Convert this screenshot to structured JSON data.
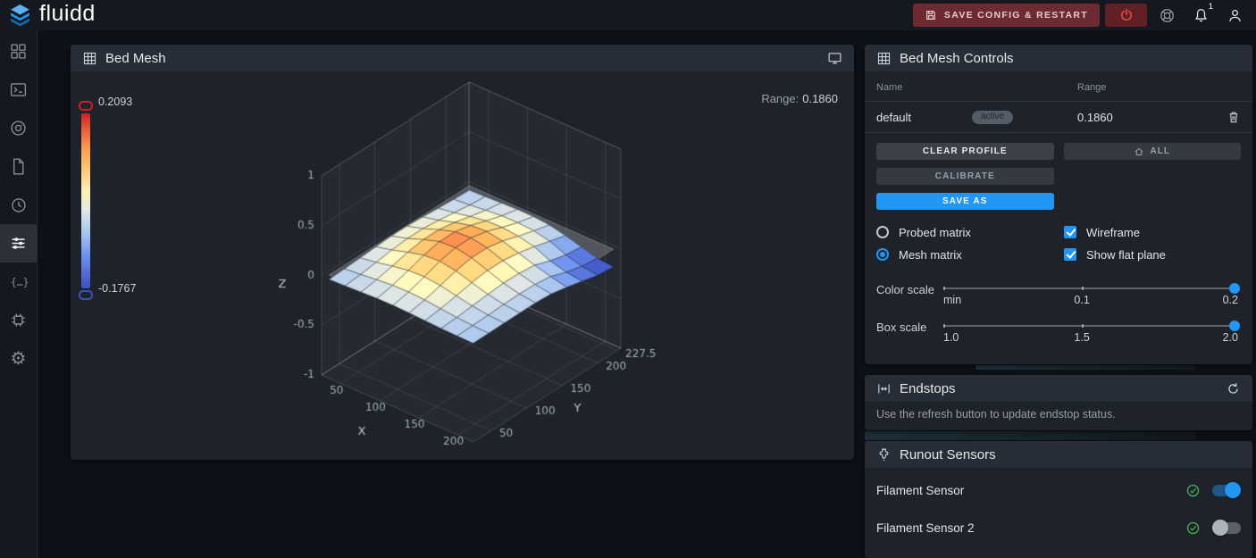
{
  "topbar": {
    "logo": "fluidd",
    "save_config_label": "SAVE CONFIG & RESTART",
    "notification_count": "1"
  },
  "sidebar": {
    "active": "tune",
    "items": [
      "dashboard",
      "console",
      "camera",
      "jobs",
      "history",
      "tune",
      "macros",
      "system",
      "settings"
    ]
  },
  "bed_mesh_card": {
    "title": "Bed Mesh",
    "range_label": "Range:",
    "range_value": "0.1860",
    "colorbar_max": "0.2093",
    "colorbar_min": "-0.1767"
  },
  "chart_data": {
    "type": "surface",
    "title": "Bed Mesh",
    "xlabel": "X",
    "ylabel": "Y",
    "zlabel": "Z",
    "x_range": [
      25,
      220
    ],
    "y_range": [
      25,
      232.5
    ],
    "z_range": [
      -1,
      1
    ],
    "x_ticks": [
      50,
      100,
      150,
      200
    ],
    "y_ticks": [
      50,
      100,
      150,
      200,
      227.5
    ],
    "z_ticks": [
      1,
      0.5,
      0,
      -0.5,
      -1
    ],
    "color_min": -0.1767,
    "color_max": 0.2093,
    "flat_plane": true,
    "wireframe": true,
    "colorscale": [
      [
        0,
        "#3b4fc1"
      ],
      [
        0.18,
        "#6b8ff0"
      ],
      [
        0.32,
        "#a8c6f0"
      ],
      [
        0.45,
        "#e2e8e4"
      ],
      [
        0.55,
        "#fbf2b8"
      ],
      [
        0.68,
        "#fdc877"
      ],
      [
        0.8,
        "#fb9b4f"
      ],
      [
        0.9,
        "#ee613d"
      ],
      [
        1,
        "#cb2026"
      ]
    ],
    "x": [
      30,
      50.6,
      71.1,
      91.7,
      112.2,
      132.8,
      153.3,
      173.9,
      194.4,
      215
    ],
    "y": [
      30,
      51.9,
      73.9,
      95.8,
      117.8,
      139.7,
      161.7,
      183.6,
      205.6,
      227.5
    ],
    "z": [
      [
        -0.045,
        -0.039,
        -0.031,
        -0.024,
        -0.023,
        -0.027,
        -0.035,
        -0.042,
        -0.047,
        -0.049
      ],
      [
        -0.038,
        -0.024,
        -0.006,
        0.009,
        0.012,
        0.004,
        -0.014,
        -0.031,
        -0.042,
        -0.048
      ],
      [
        -0.028,
        -0.002,
        0.031,
        0.058,
        0.065,
        0.048,
        0.016,
        -0.015,
        -0.036,
        -0.045
      ],
      [
        -0.016,
        0.022,
        0.071,
        0.112,
        0.122,
        0.096,
        0.049,
        0.003,
        -0.028,
        -0.043
      ],
      [
        -0.008,
        0.038,
        0.098,
        0.148,
        0.158,
        0.128,
        0.071,
        0.015,
        -0.023,
        -0.041
      ],
      [
        -0.008,
        0.038,
        0.098,
        0.148,
        0.158,
        0.128,
        0.071,
        0.013,
        -0.027,
        -0.052
      ],
      [
        -0.016,
        0.022,
        0.071,
        0.112,
        0.122,
        0.096,
        0.047,
        -0.004,
        -0.048,
        -0.084
      ],
      [
        -0.028,
        -0.002,
        0.031,
        0.058,
        0.064,
        0.046,
        0.012,
        -0.06,
        -0.104,
        -0.122
      ],
      [
        -0.038,
        -0.024,
        -0.006,
        0.009,
        0.011,
        0.0,
        -0.034,
        -0.099,
        -0.143,
        -0.163
      ],
      [
        -0.045,
        -0.039,
        -0.031,
        -0.025,
        -0.026,
        -0.04,
        -0.076,
        -0.119,
        -0.162,
        -0.1767
      ]
    ]
  },
  "controls_card": {
    "title": "Bed Mesh Controls",
    "col_name": "Name",
    "col_range": "Range",
    "profile": {
      "name": "default",
      "badge": "active",
      "range": "0.1860"
    },
    "btn_clear": "CLEAR PROFILE",
    "btn_all": "ALL",
    "btn_calibrate": "CALIBRATE",
    "btn_save_as": "SAVE AS",
    "radio_probed": {
      "label": "Probed matrix",
      "selected": false
    },
    "radio_mesh": {
      "label": "Mesh matrix",
      "selected": true
    },
    "check_wireframe": {
      "label": "Wireframe",
      "checked": true
    },
    "check_flat": {
      "label": "Show flat plane",
      "checked": true
    },
    "color_scale": {
      "label": "Color scale",
      "tick_labels": [
        "min",
        "0.1",
        "0.2"
      ],
      "value": 1
    },
    "box_scale": {
      "label": "Box scale",
      "tick_labels": [
        "1.0",
        "1.5",
        "2.0"
      ],
      "value": 1
    }
  },
  "endstops_card": {
    "title": "Endstops",
    "hint": "Use the refresh button to update endstop status."
  },
  "runout_card": {
    "title": "Runout Sensors",
    "sensors": [
      {
        "label": "Filament Sensor",
        "enabled": true
      },
      {
        "label": "Filament Sensor 2",
        "enabled": false
      }
    ]
  },
  "colors": {
    "accent": "#2196f3",
    "success": "#4caf50",
    "danger": "#ef4b46",
    "save_button_bg": "#6d2b31"
  }
}
